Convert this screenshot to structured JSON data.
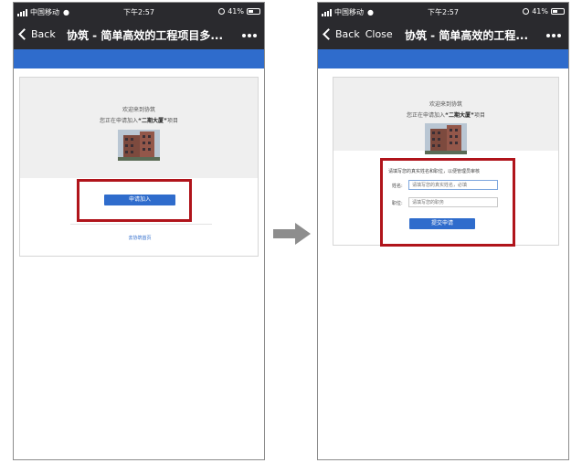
{
  "left_phone": {
    "status": {
      "carrier": "中国移动",
      "time": "下午2:57",
      "battery": "41%"
    },
    "nav": {
      "back_label": "Back",
      "title": "协筑 - 简单高效的工程项目多..."
    },
    "card": {
      "welcome": "欢迎来到协筑",
      "joining_prefix": "您正在申请加入",
      "project_name": "“二期大厦”",
      "joining_suffix": "项目",
      "apply_button": "申请加入",
      "home_link": "去协筑首页"
    }
  },
  "right_phone": {
    "status": {
      "carrier": "中国移动",
      "time": "下午2:57",
      "battery": "41%"
    },
    "nav": {
      "back_label": "Back",
      "close_label": "Close",
      "title": "协筑 - 简单高效的工程..."
    },
    "card": {
      "welcome": "欢迎来到协筑",
      "joining_prefix": "您正在申请加入",
      "project_name": "“二期大厦”",
      "joining_suffix": "项目",
      "prompt": "请填写您的真实姓名和职位，以便管理员审核",
      "name_label": "姓名:",
      "name_placeholder": "请填写您的真实姓名，必填",
      "position_label": "职位:",
      "position_placeholder": "请填写您的职务",
      "submit_button": "提交申请"
    }
  },
  "colors": {
    "accent_blue": "#2f6ccc",
    "highlight_red": "#b0141b",
    "bar_dark": "#2a2a2e"
  }
}
